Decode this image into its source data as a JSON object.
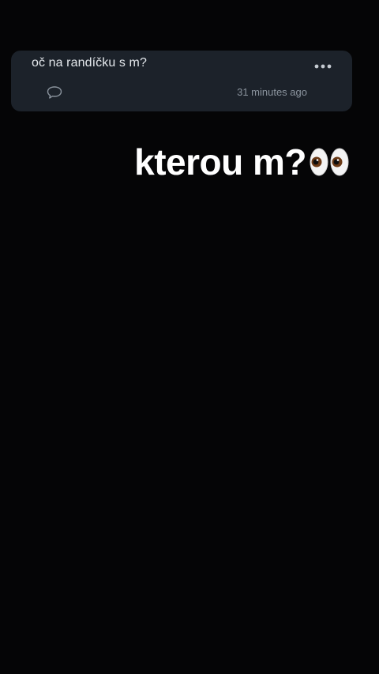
{
  "card": {
    "question": "oč na randíčku s m?",
    "timestamp": "31 minutes ago",
    "icons": {
      "more": "more-horizontal-icon",
      "comment": "comment-bubble-icon"
    }
  },
  "caption": {
    "text": "kterou m?",
    "emoji": "eyes-emoji"
  },
  "colors": {
    "background": "#050506",
    "card_background": "#1c222a",
    "card_text": "#e4e8ec",
    "muted_text": "#8b949e",
    "caption_text": "#ffffff"
  }
}
